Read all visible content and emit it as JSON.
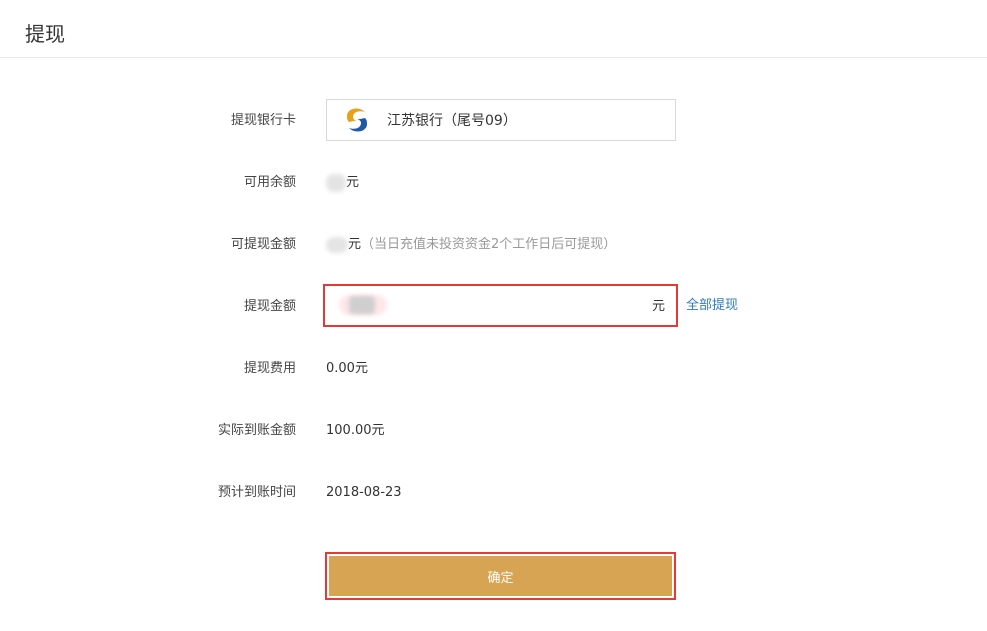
{
  "page": {
    "title": "提现"
  },
  "bank": {
    "label": "提现银行卡",
    "name": "江苏银行（尾号09）",
    "logo_icon": "jiangsu-bank-logo"
  },
  "available": {
    "label": "可用余额",
    "unit": "元"
  },
  "withdrawable": {
    "label": "可提现金额",
    "unit": "元",
    "note": "（当日充值未投资资金2个工作日后可提现）"
  },
  "amount": {
    "label": "提现金额",
    "unit": "元",
    "all_link": "全部提现"
  },
  "fee": {
    "label": "提现费用",
    "value": "0.00元"
  },
  "actual": {
    "label": "实际到账金额",
    "value": "100.00元"
  },
  "eta": {
    "label": "预计到账时间",
    "value": "2018-08-23"
  },
  "confirm": {
    "label": "确定"
  },
  "colors": {
    "accent": "#d6a453",
    "link": "#2f7bc0",
    "highlight": "#e53935"
  }
}
